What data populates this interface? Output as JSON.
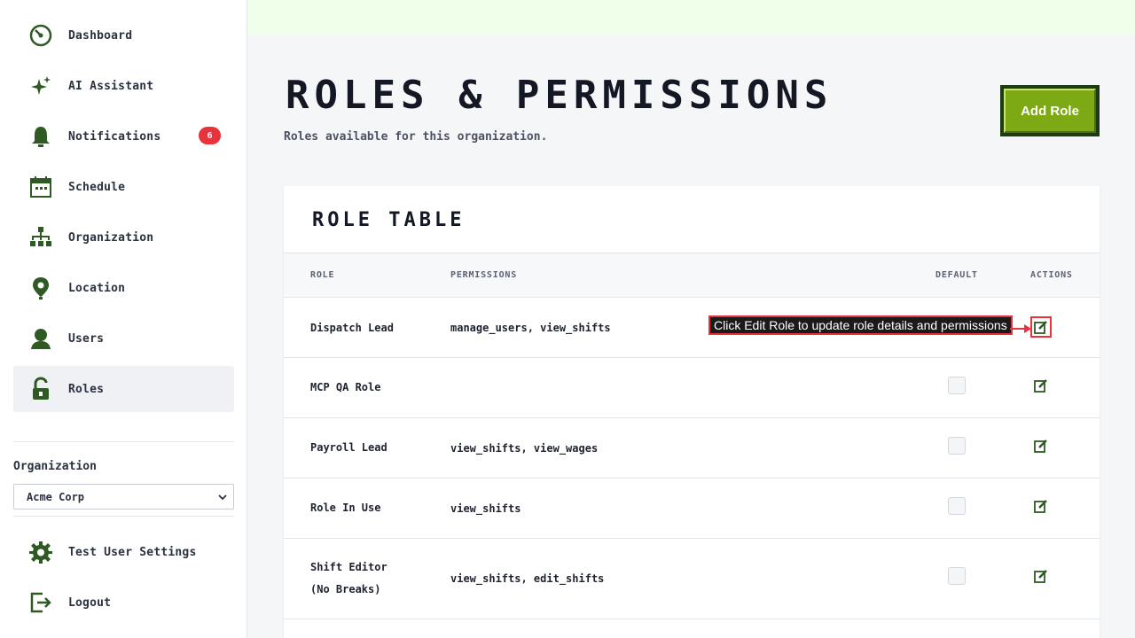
{
  "sidebar": {
    "items": [
      {
        "label": "Dashboard",
        "icon": "dashboard-icon"
      },
      {
        "label": "AI Assistant",
        "icon": "sparkle-icon"
      },
      {
        "label": "Notifications",
        "icon": "bell-icon",
        "badge": "6"
      },
      {
        "label": "Schedule",
        "icon": "calendar-icon"
      },
      {
        "label": "Organization",
        "icon": "org-chart-icon"
      },
      {
        "label": "Location",
        "icon": "location-pin-icon"
      },
      {
        "label": "Users",
        "icon": "user-icon"
      },
      {
        "label": "Roles",
        "icon": "lock-icon",
        "active": true
      }
    ],
    "org_label": "Organization",
    "org_selected": "Acme Corp",
    "bottom_items": [
      {
        "label": "Test User Settings",
        "icon": "gear-icon"
      },
      {
        "label": "Logout",
        "icon": "logout-icon"
      }
    ]
  },
  "header": {
    "title": "Roles & Permissions",
    "subtitle": "Roles available for this organization.",
    "add_button": "Add Role"
  },
  "table": {
    "title": "Role Table",
    "columns": [
      "Role",
      "Permissions",
      "Default",
      "Actions"
    ],
    "rows": [
      {
        "role": "Dispatch Lead",
        "permissions": "manage_users, view_shifts"
      },
      {
        "role": "MCP QA Role",
        "permissions": ""
      },
      {
        "role": "Payroll Lead",
        "permissions": "view_shifts, view_wages"
      },
      {
        "role": "Role In Use",
        "permissions": "view_shifts"
      },
      {
        "role": "Shift Editor (No Breaks)",
        "permissions": "view_shifts, edit_shifts"
      }
    ]
  },
  "callout": {
    "text": "Click Edit Role to update role details and permissions"
  },
  "colors": {
    "accent_green": "#7da915",
    "dark_green": "#1d3b12",
    "icon_green": "#2f5a23",
    "badge_red": "#e8323c",
    "topbar": "#efffe9"
  }
}
